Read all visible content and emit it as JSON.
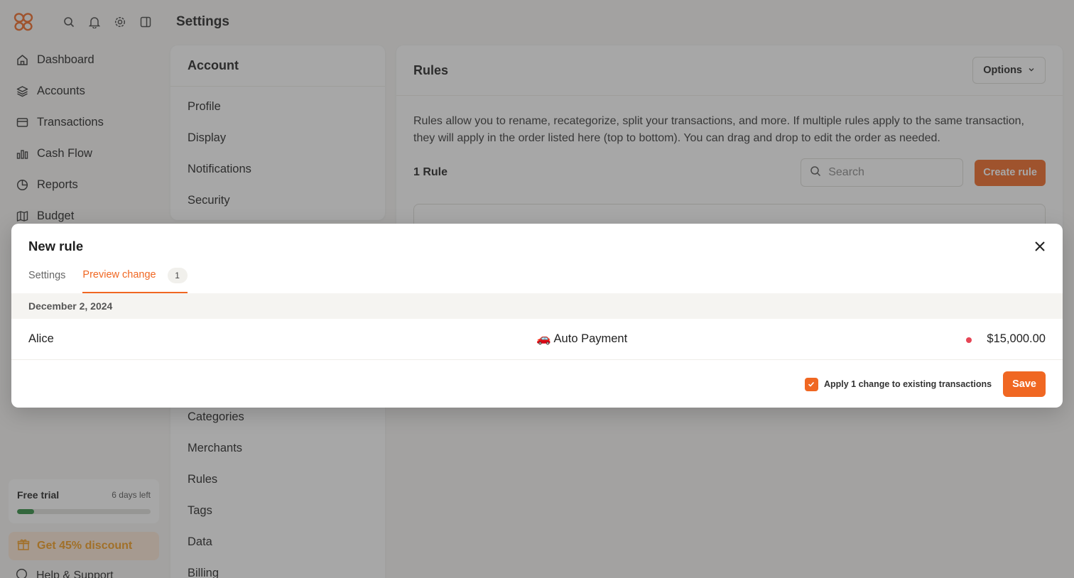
{
  "header": {
    "title": "Settings"
  },
  "topbar": {
    "icons": [
      "search-icon",
      "bell-icon",
      "gear-icon",
      "sidebar-toggle-icon"
    ]
  },
  "sidebar": {
    "items": [
      {
        "label": "Dashboard",
        "icon": "home-icon"
      },
      {
        "label": "Accounts",
        "icon": "layers-icon"
      },
      {
        "label": "Transactions",
        "icon": "credit-card-icon"
      },
      {
        "label": "Cash Flow",
        "icon": "bar-chart-icon"
      },
      {
        "label": "Reports",
        "icon": "pie-chart-icon"
      },
      {
        "label": "Budget",
        "icon": "map-icon"
      }
    ],
    "trial": {
      "label": "Free trial",
      "days_left": "6 days left",
      "progress": 0.13
    },
    "discount_label": "Get 45% discount",
    "help_label": "Help & Support"
  },
  "account_menu": {
    "title": "Account",
    "items_top": [
      "Profile",
      "Display",
      "Notifications",
      "Security"
    ],
    "items_bottom": [
      "Categories",
      "Merchants",
      "Rules",
      "Tags",
      "Data",
      "Billing"
    ]
  },
  "rules": {
    "title": "Rules",
    "options_label": "Options",
    "description": "Rules allow you to rename, recategorize, split your transactions, and more. If multiple rules apply to the same transaction, they will apply in the order listed here (top to bottom). You can drag and drop to edit the order as needed.",
    "count_label": "1 Rule",
    "search_placeholder": "Search",
    "create_label": "Create rule"
  },
  "modal": {
    "title": "New rule",
    "tabs": [
      {
        "label": "Settings",
        "active": false
      },
      {
        "label": "Preview change",
        "active": true,
        "badge": "1"
      }
    ],
    "date": "December 2, 2024",
    "transaction": {
      "name": "Alice",
      "merchant_emoji": "🚗",
      "merchant": "Auto Payment",
      "amount": "$15,000.00",
      "status_color": "#e64555"
    },
    "apply_label": "Apply 1 change to existing transactions",
    "apply_checked": true,
    "save_label": "Save"
  },
  "colors": {
    "accent": "#f06722",
    "progress": "#2c8a3e",
    "discount_text": "#f59c1a"
  }
}
